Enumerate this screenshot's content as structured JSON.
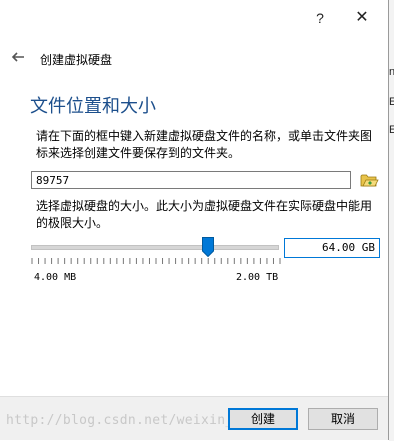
{
  "window": {
    "help_label": "?",
    "close_label": "✕",
    "header_title": "创建虚拟硬盘"
  },
  "section": {
    "title": "文件位置和大小",
    "location_description": "请在下面的框中键入新建虚拟硬盘文件的名称，或单击文件夹图标来选择创建文件要保存到的文件夹。",
    "file_name_value": "89757",
    "size_description": "选择虚拟硬盘的大小。此大小为虚拟硬盘文件在实际硬盘中能用的极限大小。"
  },
  "slider": {
    "min_label": "4.00 MB",
    "max_label": "2.00 TB",
    "value_fraction": 0.72,
    "size_value": "64.00 GB"
  },
  "buttons": {
    "create_label": "创建",
    "cancel_label": "取消"
  },
  "watermark": "http://blog.csdn.net/weixin_43763077",
  "background_window_chars": [
    "n",
    "E",
    "E"
  ],
  "colors": {
    "accent": "#0078d7",
    "title_blue": "#1c4f8c",
    "folder_yellow": "#e8c34a",
    "folder_green": "#3a9a3a"
  },
  "icons": {
    "back": "back-arrow-icon",
    "folder": "folder-icon"
  }
}
